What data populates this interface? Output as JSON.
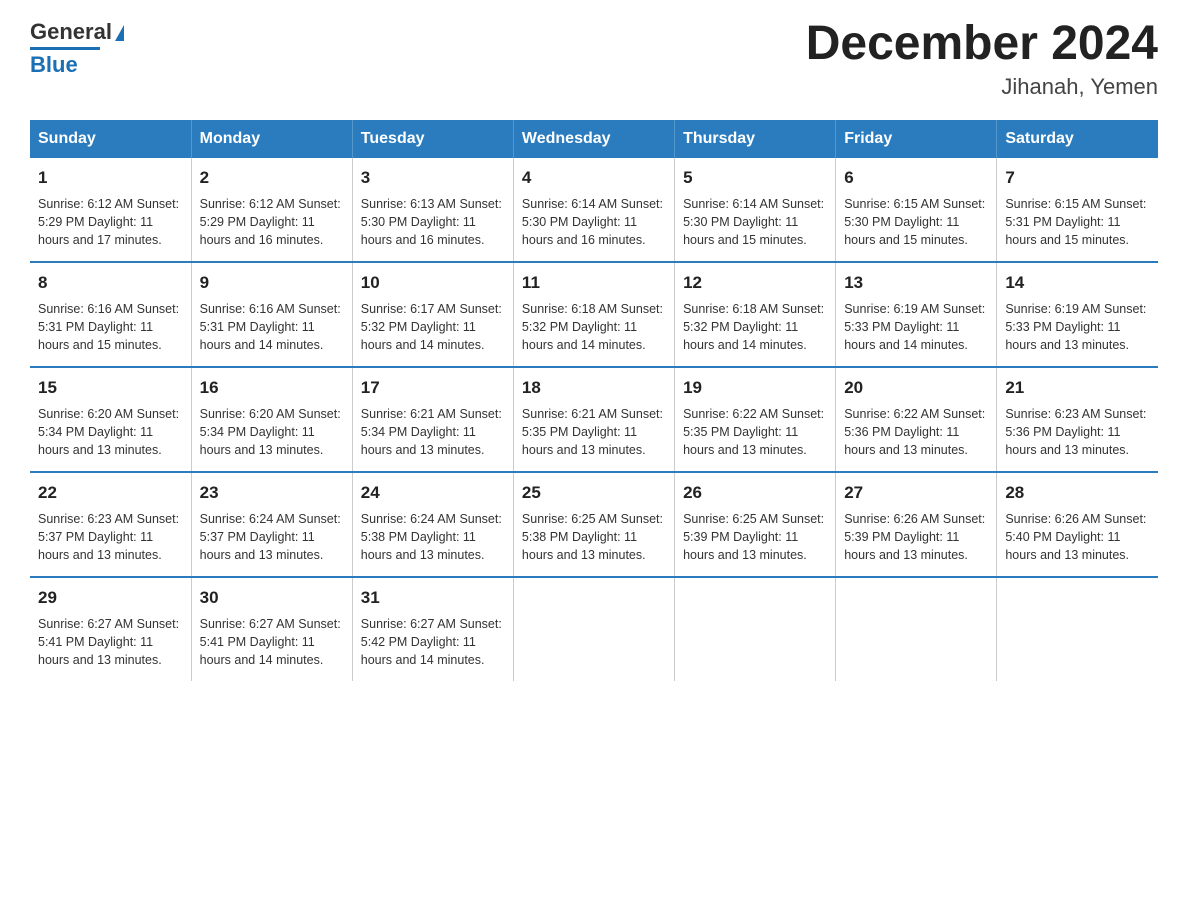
{
  "header": {
    "logo_line1": "General",
    "logo_line2": "Blue",
    "month_title": "December 2024",
    "location": "Jihanah, Yemen"
  },
  "days_of_week": [
    "Sunday",
    "Monday",
    "Tuesday",
    "Wednesday",
    "Thursday",
    "Friday",
    "Saturday"
  ],
  "weeks": [
    [
      {
        "day": "1",
        "info": "Sunrise: 6:12 AM\nSunset: 5:29 PM\nDaylight: 11 hours\nand 17 minutes."
      },
      {
        "day": "2",
        "info": "Sunrise: 6:12 AM\nSunset: 5:29 PM\nDaylight: 11 hours\nand 16 minutes."
      },
      {
        "day": "3",
        "info": "Sunrise: 6:13 AM\nSunset: 5:30 PM\nDaylight: 11 hours\nand 16 minutes."
      },
      {
        "day": "4",
        "info": "Sunrise: 6:14 AM\nSunset: 5:30 PM\nDaylight: 11 hours\nand 16 minutes."
      },
      {
        "day": "5",
        "info": "Sunrise: 6:14 AM\nSunset: 5:30 PM\nDaylight: 11 hours\nand 15 minutes."
      },
      {
        "day": "6",
        "info": "Sunrise: 6:15 AM\nSunset: 5:30 PM\nDaylight: 11 hours\nand 15 minutes."
      },
      {
        "day": "7",
        "info": "Sunrise: 6:15 AM\nSunset: 5:31 PM\nDaylight: 11 hours\nand 15 minutes."
      }
    ],
    [
      {
        "day": "8",
        "info": "Sunrise: 6:16 AM\nSunset: 5:31 PM\nDaylight: 11 hours\nand 15 minutes."
      },
      {
        "day": "9",
        "info": "Sunrise: 6:16 AM\nSunset: 5:31 PM\nDaylight: 11 hours\nand 14 minutes."
      },
      {
        "day": "10",
        "info": "Sunrise: 6:17 AM\nSunset: 5:32 PM\nDaylight: 11 hours\nand 14 minutes."
      },
      {
        "day": "11",
        "info": "Sunrise: 6:18 AM\nSunset: 5:32 PM\nDaylight: 11 hours\nand 14 minutes."
      },
      {
        "day": "12",
        "info": "Sunrise: 6:18 AM\nSunset: 5:32 PM\nDaylight: 11 hours\nand 14 minutes."
      },
      {
        "day": "13",
        "info": "Sunrise: 6:19 AM\nSunset: 5:33 PM\nDaylight: 11 hours\nand 14 minutes."
      },
      {
        "day": "14",
        "info": "Sunrise: 6:19 AM\nSunset: 5:33 PM\nDaylight: 11 hours\nand 13 minutes."
      }
    ],
    [
      {
        "day": "15",
        "info": "Sunrise: 6:20 AM\nSunset: 5:34 PM\nDaylight: 11 hours\nand 13 minutes."
      },
      {
        "day": "16",
        "info": "Sunrise: 6:20 AM\nSunset: 5:34 PM\nDaylight: 11 hours\nand 13 minutes."
      },
      {
        "day": "17",
        "info": "Sunrise: 6:21 AM\nSunset: 5:34 PM\nDaylight: 11 hours\nand 13 minutes."
      },
      {
        "day": "18",
        "info": "Sunrise: 6:21 AM\nSunset: 5:35 PM\nDaylight: 11 hours\nand 13 minutes."
      },
      {
        "day": "19",
        "info": "Sunrise: 6:22 AM\nSunset: 5:35 PM\nDaylight: 11 hours\nand 13 minutes."
      },
      {
        "day": "20",
        "info": "Sunrise: 6:22 AM\nSunset: 5:36 PM\nDaylight: 11 hours\nand 13 minutes."
      },
      {
        "day": "21",
        "info": "Sunrise: 6:23 AM\nSunset: 5:36 PM\nDaylight: 11 hours\nand 13 minutes."
      }
    ],
    [
      {
        "day": "22",
        "info": "Sunrise: 6:23 AM\nSunset: 5:37 PM\nDaylight: 11 hours\nand 13 minutes."
      },
      {
        "day": "23",
        "info": "Sunrise: 6:24 AM\nSunset: 5:37 PM\nDaylight: 11 hours\nand 13 minutes."
      },
      {
        "day": "24",
        "info": "Sunrise: 6:24 AM\nSunset: 5:38 PM\nDaylight: 11 hours\nand 13 minutes."
      },
      {
        "day": "25",
        "info": "Sunrise: 6:25 AM\nSunset: 5:38 PM\nDaylight: 11 hours\nand 13 minutes."
      },
      {
        "day": "26",
        "info": "Sunrise: 6:25 AM\nSunset: 5:39 PM\nDaylight: 11 hours\nand 13 minutes."
      },
      {
        "day": "27",
        "info": "Sunrise: 6:26 AM\nSunset: 5:39 PM\nDaylight: 11 hours\nand 13 minutes."
      },
      {
        "day": "28",
        "info": "Sunrise: 6:26 AM\nSunset: 5:40 PM\nDaylight: 11 hours\nand 13 minutes."
      }
    ],
    [
      {
        "day": "29",
        "info": "Sunrise: 6:27 AM\nSunset: 5:41 PM\nDaylight: 11 hours\nand 13 minutes."
      },
      {
        "day": "30",
        "info": "Sunrise: 6:27 AM\nSunset: 5:41 PM\nDaylight: 11 hours\nand 14 minutes."
      },
      {
        "day": "31",
        "info": "Sunrise: 6:27 AM\nSunset: 5:42 PM\nDaylight: 11 hours\nand 14 minutes."
      },
      {
        "day": "",
        "info": ""
      },
      {
        "day": "",
        "info": ""
      },
      {
        "day": "",
        "info": ""
      },
      {
        "day": "",
        "info": ""
      }
    ]
  ]
}
